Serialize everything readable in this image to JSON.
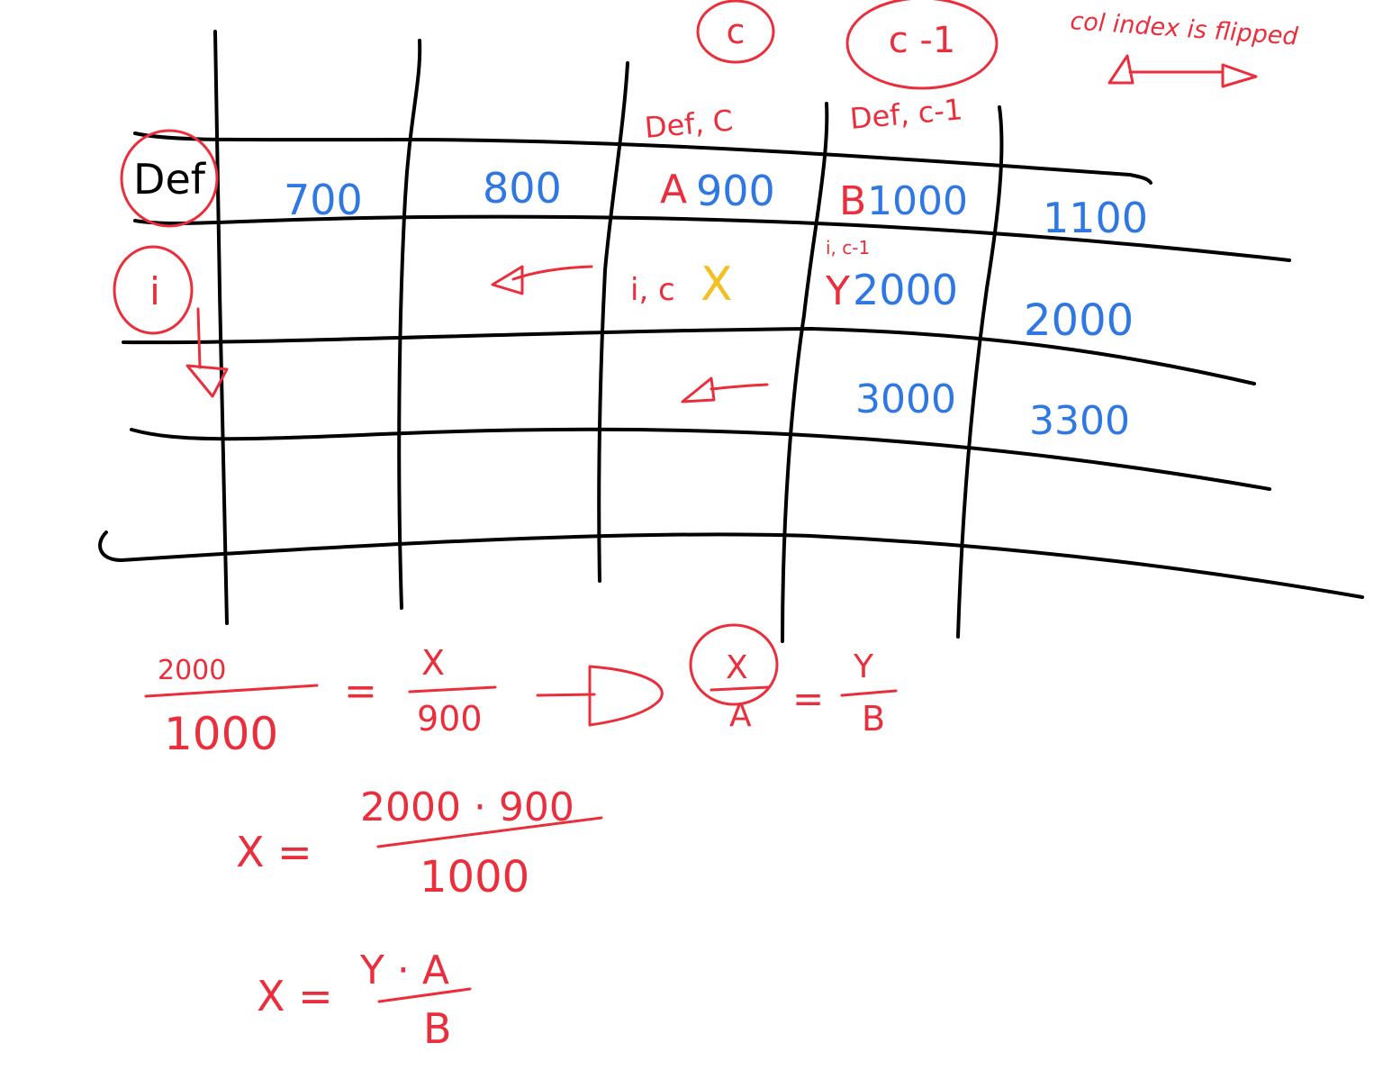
{
  "header": {
    "col_c_circled": "c",
    "col_c_minus_1_circled": "c -1",
    "note_col_index": "col index is flipped"
  },
  "column_labels": {
    "def_c": "Def, C",
    "def_c_minus_1": "Def, c-1"
  },
  "row_labels": {
    "def": "Def",
    "i": "i"
  },
  "grid": {
    "def_row": {
      "col1": "700",
      "col2": "800",
      "col3_letter": "A",
      "col3_value": "900",
      "col4_letter": "B",
      "col4_value": "1000",
      "col5": "1100"
    },
    "i_row": {
      "col3_label": "i, c",
      "col3_mark": "X",
      "col4_small_label": "i, c-1",
      "col4_letter": "Y",
      "col4_value": "2000",
      "col5": "2000"
    },
    "row3": {
      "col4": "3000",
      "col5": "3300"
    }
  },
  "equations": {
    "eq1_num_left": "2000",
    "eq1_den_left": "1000",
    "eq1_equals": "=",
    "eq1_num_right": "X",
    "eq1_den_right": "900",
    "eq2_num_left": "X",
    "eq2_den_left": "A",
    "eq2_equals": "=",
    "eq2_num_right": "Y",
    "eq2_den_right": "B",
    "eq3_lhs": "X =",
    "eq3_num": "2000 · 900",
    "eq3_den": "1000",
    "eq4_lhs": "X =",
    "eq4_num": "Y · A",
    "eq4_den": "B"
  },
  "colors": {
    "grid_ink": "#000000",
    "annotation_red": "#ea2e3b",
    "value_blue": "#2f78e3",
    "mark_yellow": "#f2c023"
  }
}
